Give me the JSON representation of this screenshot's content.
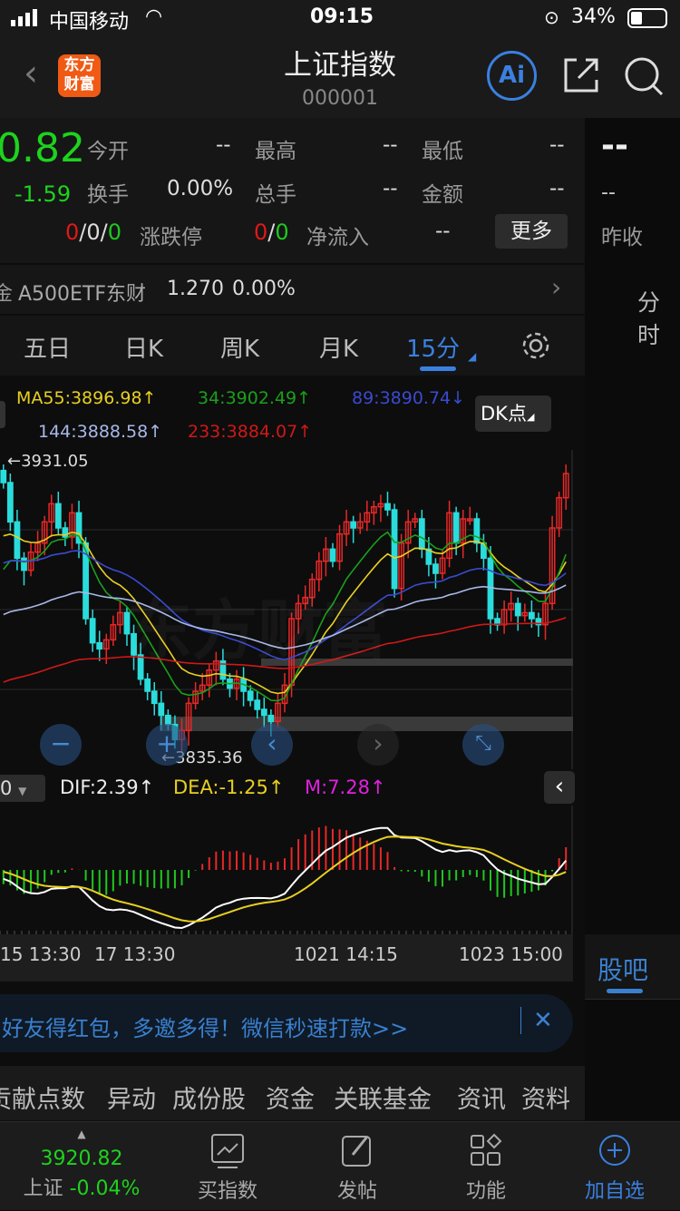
{
  "status": {
    "carrier": "中国移动",
    "time": "09:15",
    "battery": "34%"
  },
  "header": {
    "title": "上证指数",
    "code": "000001",
    "logo_text": "东方财富"
  },
  "quote": {
    "price": "0.82",
    "change": "-1.59",
    "fields": [
      {
        "label": "今开",
        "value": "--"
      },
      {
        "label": "最高",
        "value": "--"
      },
      {
        "label": "最低",
        "value": "--"
      },
      {
        "label": "换手",
        "value": "0.00%"
      },
      {
        "label": "总手",
        "value": "--"
      },
      {
        "label": "金额",
        "value": "--"
      }
    ],
    "limit_counts": {
      "up": "0",
      "flat": "0",
      "down": "0",
      "label": "涨跌停"
    },
    "netflow": {
      "in": "0",
      "out": "0",
      "label": "净流入",
      "value": "--"
    },
    "more_label": "更多",
    "right": {
      "big": "--",
      "small": "--",
      "label": "昨收"
    }
  },
  "etf": {
    "prefix": "金",
    "name": "A500ETF东财",
    "price": "1.270",
    "pct": "0.00%"
  },
  "right_tabs": {
    "top": "分时",
    "bottom": "股吧"
  },
  "tabs": [
    "五日",
    "日K",
    "周K",
    "月K",
    "15分"
  ],
  "active_tab": 4,
  "ma_legend": [
    {
      "text": "MA55:3896.98↑",
      "color": "#e8d020"
    },
    {
      "text": "34:3902.49↑",
      "color": "#1aa01a"
    },
    {
      "text": "89:3890.74↓",
      "color": "#3a4ad0"
    },
    {
      "text": "144:3888.58↑",
      "color": "#a8b8e8"
    },
    {
      "text": "233:3884.07↑",
      "color": "#d01818"
    }
  ],
  "dk_label": "DK点",
  "macd_legend": {
    "select": "0",
    "dif": "DIF:2.39↑",
    "dea": "DEA:-1.25↑",
    "m": "M:7.28↑"
  },
  "axis_labels": [
    "15 13:30",
    "17 13:30",
    "1021 14:15",
    "1023 15:00"
  ],
  "banner": {
    "text": "好友得红包，多邀多得！微信秒速打款>>"
  },
  "bottom_tabs": [
    "贡献点数",
    "异动",
    "成份股",
    "资金",
    "关联基金",
    "资讯",
    "资料"
  ],
  "footer": {
    "index_price": "3920.82",
    "index_name": "上证",
    "index_pct": "-0.04%",
    "items": [
      "买指数",
      "发帖",
      "功能",
      "加自选"
    ]
  },
  "chart_data": {
    "type": "candlestick",
    "high_label": "3931.05",
    "low_label": "3835.36",
    "ylim": [
      3832,
      3934
    ],
    "closes": [
      3925,
      3912,
      3900,
      3896,
      3902,
      3905,
      3912,
      3918,
      3910,
      3907,
      3915,
      3905,
      3880,
      3872,
      3870,
      3873,
      3878,
      3882,
      3875,
      3868,
      3860,
      3856,
      3852,
      3848,
      3845,
      3840,
      3843,
      3852,
      3856,
      3858,
      3863,
      3866,
      3860,
      3857,
      3860,
      3856,
      3853,
      3850,
      3848,
      3846,
      3852,
      3858,
      3880,
      3885,
      3887,
      3893,
      3899,
      3903,
      3899,
      3908,
      3912,
      3910,
      3912,
      3915,
      3917,
      3918,
      3916,
      3890,
      3905,
      3912,
      3913,
      3903,
      3898,
      3895,
      3900,
      3915,
      3905,
      3913,
      3913,
      3905,
      3900,
      3880,
      3878,
      3883,
      3885,
      3881,
      3882,
      3880,
      3878,
      3885,
      3910,
      3920,
      3928
    ]
  }
}
